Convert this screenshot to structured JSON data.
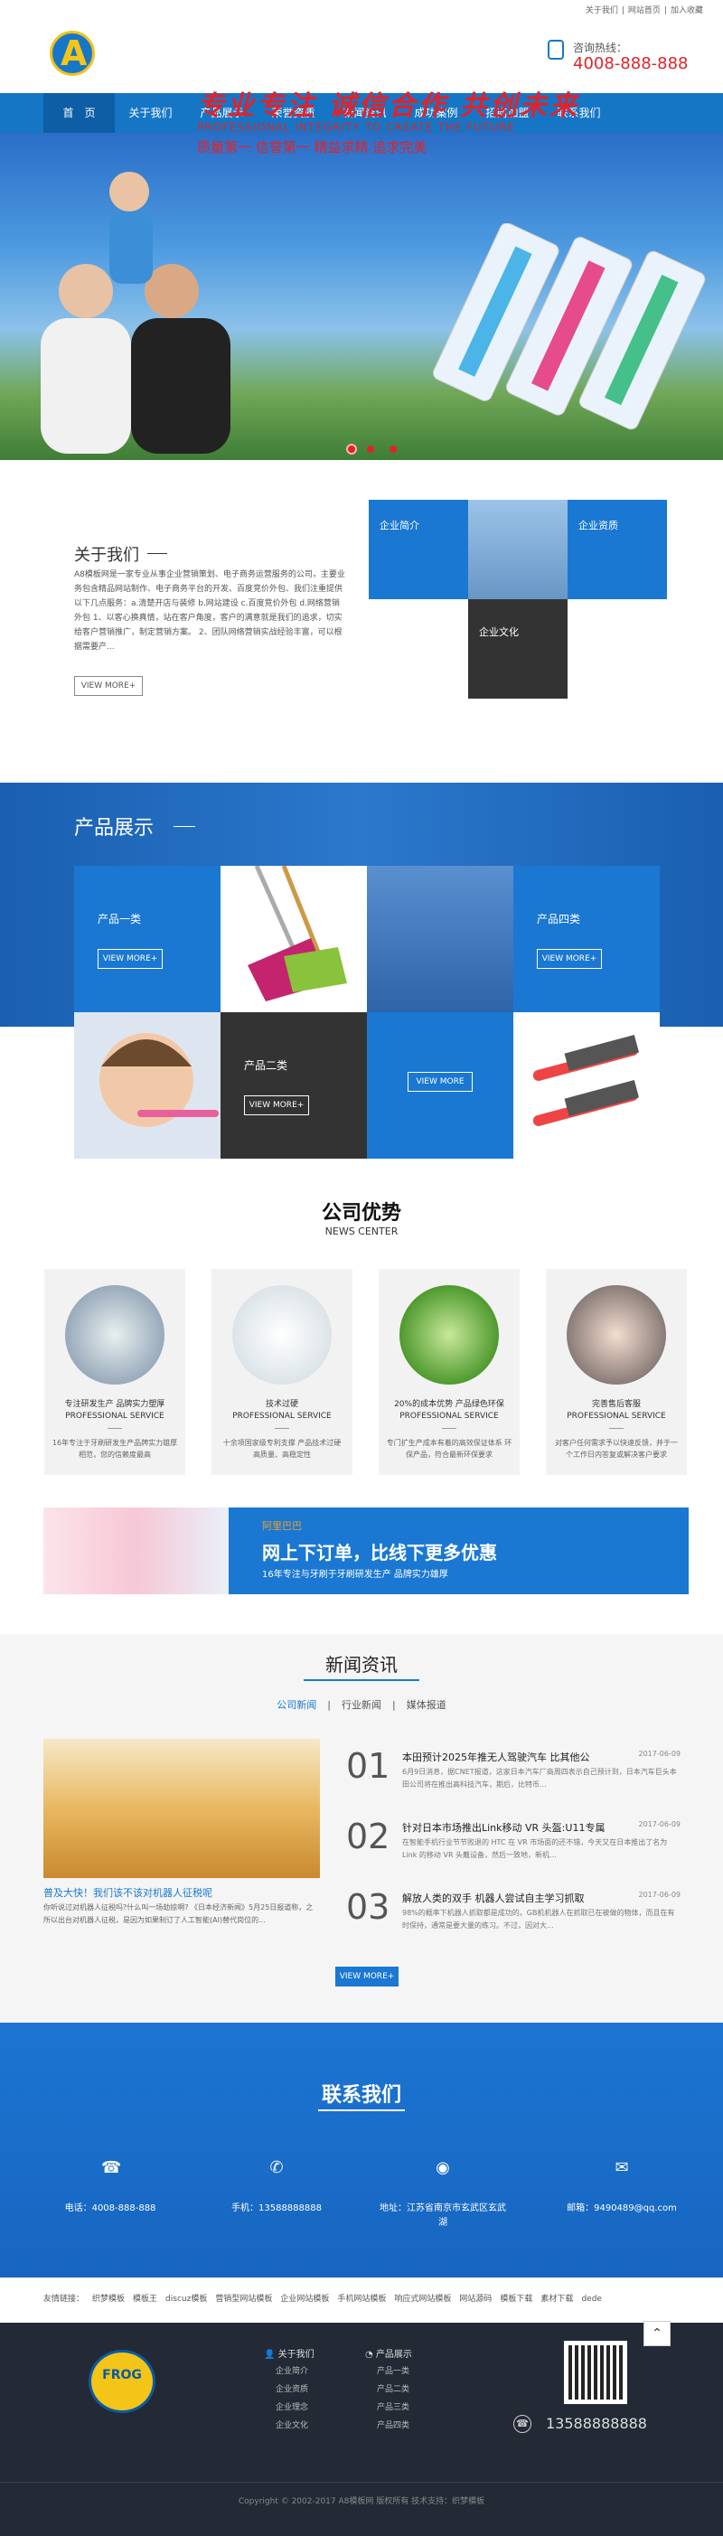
{
  "topbar": {
    "links": [
      "关于我们",
      "|",
      "网站首页",
      "|",
      "加入收藏"
    ]
  },
  "header": {
    "hotline_label": "咨询热线：",
    "hotline": "4008-888-888"
  },
  "nav": [
    "首　页",
    "关于我们",
    "产品展示",
    "荣誉资质",
    "新闻资讯",
    "成功案例",
    "招商加盟",
    "联系我们"
  ],
  "banner": {
    "slogan": "专业专注 诚信合作 共创未来",
    "slogan_en": "PROFESSIONAL INTEGRITY TO CREATE THE FUTURE",
    "tagline": "质量第一 信誉第一 精益求精 追求完美"
  },
  "about": {
    "title": "关于我们",
    "text": "A8模板网是一家专业从事企业营销策划、电子商务运营服务的公司，主要业务包含精品网站制作、电子商务平台的开发、百度竞价外包、我们注重提供以下几点服务：a.清楚开店与装修 b.网站建设 c.百度竞价外包 d.网络营销外包 1、以客心换真情，站在客户角度，客户的满意就是我们的追求，切实给客户营销推广，制定营销方案。 2、团队网络营销实战经验丰富，可以根据需要产...",
    "more": "VIEW MORE+",
    "tiles": {
      "intro": "企业简介",
      "qual": "企业资质",
      "culture": "企业文化"
    }
  },
  "products": {
    "title": "产品展示",
    "cat1": "产品一类",
    "cat2": "产品二类",
    "cat4": "产品四类",
    "more": "VIEW MORE+",
    "more_center": "VIEW MORE"
  },
  "advantages": {
    "title": "公司优势",
    "subtitle": "NEWS CENTER",
    "cards": [
      {
        "t1": "专注研发生产 品牌实力塑厚",
        "t2": "PROFESSIONAL SERVICE",
        "t3": "16年专注于牙刷研发生产品牌实力雄厚相范，您的信赖度最高"
      },
      {
        "t1": "技术过硬",
        "t2": "PROFESSIONAL SERVICE",
        "t3": "十余项国家级专利支撑 产品技术过硬 高质量、高稳定性"
      },
      {
        "t1": "20%的成本优势 产品绿色环保",
        "t2": "PROFESSIONAL SERVICE",
        "t3": "专门扩生产成本有着的高效保证体系 环保产品，符合最新环保要求"
      },
      {
        "t1": "完善售后客服",
        "t2": "PROFESSIONAL SERVICE",
        "t3": "对客户任何需求予以快速反馈，并于一个工作日内答复或解决客户要求"
      }
    ]
  },
  "promo": {
    "brand": "阿里巴巴",
    "headline": "网上下订单，比线下更多优惠",
    "sub": "16年专注与牙刷于牙刷研发生产 品牌实力雄厚"
  },
  "news": {
    "title": "新闻资讯",
    "tabs": [
      "公司新闻",
      "|",
      "行业新闻",
      "|",
      "媒体报道"
    ],
    "featured_title": "普及大快！我们该不该对机器人征税呢",
    "featured_text": "你听说过对机器人征税吗?什么叫一场劫掠啊? 《日本经济新闻》5月25日报道称，之所以出台对机器人征税，是因为如果制订了人工智能(AI)替代岗位的...",
    "items": [
      {
        "num": "01",
        "title": "本田预计2025年推无人驾驶汽车 比其他公",
        "date": "2017-06-09",
        "text": "6月9日消息，据CNET报道，这家日本汽车厂商周四表示自己预计到，日本汽车巨头本田公司将在推出高科技汽车，期后，比特币..."
      },
      {
        "num": "02",
        "title": "针对日本市场推出Link移动 VR 头盔:U11专属",
        "date": "2017-06-09",
        "text": "在智能手机行业节节败退的 HTC 在 VR 市场面的还不错，今天又在日本推出了名为 Link 的移动 VR 头戴设备，然后一致地，新机..."
      },
      {
        "num": "03",
        "title": "解放人类的双手 机器人尝试自主学习抓取",
        "date": "2017-06-09",
        "text": "98%的概率下机器人抓取都是成功的。GB机机器人在抓取已在被做的物体，而且在有时保持，通常是要大量的练习。不过，因对大..."
      }
    ],
    "more": "VIEW MORE+"
  },
  "contact": {
    "title": "联系我们",
    "items": [
      {
        "icon": "phone-icon",
        "text": "电话：4008-888-888"
      },
      {
        "icon": "phone-add-icon",
        "text": "手机：13588888888"
      },
      {
        "icon": "location-icon",
        "text": "地址：江苏省南京市玄武区玄武湖"
      },
      {
        "icon": "mail-icon",
        "text": "邮箱：9490489@qq.com"
      }
    ]
  },
  "friend_links": [
    "友情链接：",
    "织梦模板",
    "模板王",
    "discuz模板",
    "营销型网站模板",
    "企业网站模板",
    "手机网站模板",
    "响应式网站模板",
    "网站源码",
    "模板下载",
    "素材下载",
    "dede"
  ],
  "footer": {
    "col1_head": "关于我们",
    "col1": [
      "企业简介",
      "企业资质",
      "企业理念",
      "企业文化"
    ],
    "col2_head": "产品展示",
    "col2": [
      "产品一类",
      "产品二类",
      "产品三类",
      "产品四类"
    ],
    "phone": "13588888888",
    "logo_text": "FROG",
    "copyright": "Copyright © 2002-2017 A8模板网 版权所有 技术支持：织梦模板"
  }
}
